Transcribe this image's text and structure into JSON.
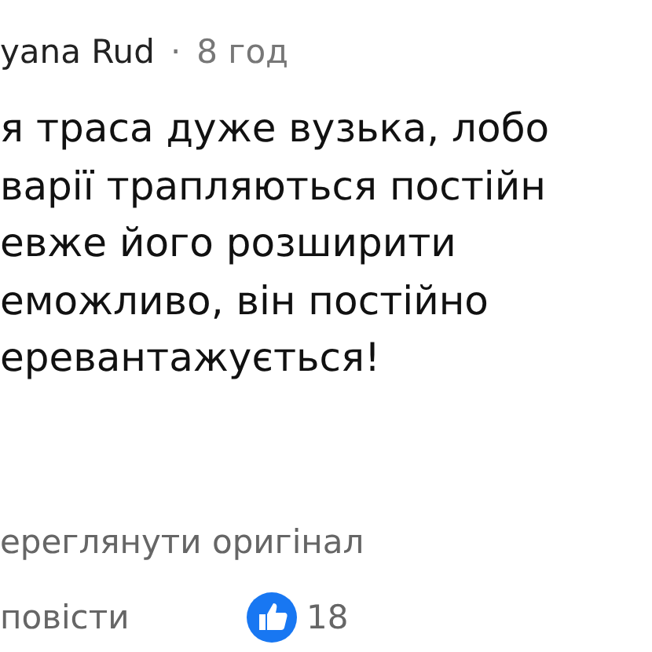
{
  "comment": {
    "author": "yana Rud",
    "separator": "·",
    "time": "8 год",
    "body_lines": [
      "я траса дуже вузька, лобо",
      "варії трапляються постійн",
      "евже його розширити",
      "еможливо, він постійно",
      "еревантажується!"
    ],
    "see_original": "ереглянути оригінал",
    "reply": "повісти",
    "likes": "18"
  }
}
